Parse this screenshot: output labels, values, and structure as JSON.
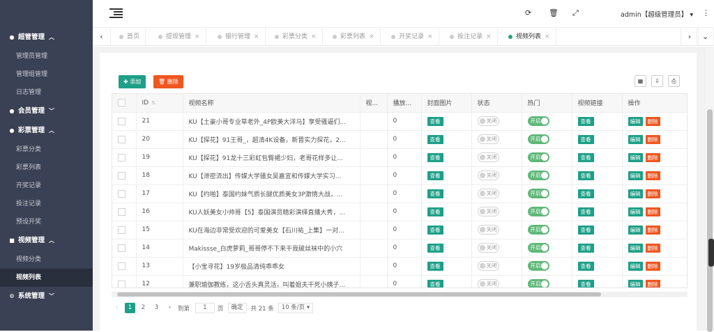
{
  "sidebar": {
    "groups": [
      {
        "label": "超管管理",
        "items": [
          "管理员管理",
          "管理组管理",
          "日志管理"
        ]
      },
      {
        "label": "会员管理",
        "items": []
      },
      {
        "label": "彩票管理",
        "items": [
          "彩票分类",
          "彩票列表",
          "开奖记录",
          "投注记录",
          "预设开奖"
        ]
      },
      {
        "label": "视频管理",
        "items": [
          "视频分类",
          "视频列表"
        ]
      },
      {
        "label": "系统管理",
        "items": []
      }
    ],
    "active_item": "视频列表"
  },
  "header": {
    "user": "admin【超级管理员】"
  },
  "tabs": [
    "首页",
    "提现管理",
    "银行管理",
    "彩票分类",
    "彩票列表",
    "开奖记录",
    "投注记录",
    "视频列表"
  ],
  "active_tab": "视频列表",
  "toolbar": {
    "add_label": "添加",
    "delete_label": "删除"
  },
  "table": {
    "columns": [
      "",
      "ID",
      "视频名称",
      "视...",
      "播放...",
      "封面图片",
      "状态",
      "热门",
      "视频链接",
      "操作"
    ],
    "cell_labels": {
      "view": "查看",
      "switch_off": "关闭",
      "switch_on": "开启",
      "edit": "编辑",
      "delete": "删除"
    },
    "rows": [
      {
        "id": "21",
        "name": "KU【土豪小哥专业草老外_4P欧美大洋马】享受骚逼们...",
        "plays": "0"
      },
      {
        "id": "20",
        "name": "KU【探花】91王哥_，超清4K设备，新晋实力探花，2...",
        "plays": "0"
      },
      {
        "id": "19",
        "name": "KU【探花】91龙十三彩虹包臀裙少妇，老哥花样多让...",
        "plays": "0"
      },
      {
        "id": "18",
        "name": "KU【泄密流出】传媒大学骚女吴嘉宜和传媒大学实习...",
        "plays": "0"
      },
      {
        "id": "17",
        "name": "KU【约啪】泰国约妹气质长腿优质美女3P激情大战，...",
        "plays": "0"
      },
      {
        "id": "16",
        "name": "KU人妖美女小帅哥【5】泰国演员精彩演绎直播大秀，...",
        "plays": "0"
      },
      {
        "id": "15",
        "name": "KU在海边非常受欢迎的可爱美女【石川祐_上集】一对...",
        "plays": "0"
      },
      {
        "id": "14",
        "name": "Makissse_白虎萝莉_哥哥停不下来干我破丝袜中的小穴",
        "plays": "0"
      },
      {
        "id": "13",
        "name": "【小宝寻花】19岁极品清纯乖乖女",
        "plays": "0"
      },
      {
        "id": "12",
        "name": "兼职瑜伽教练，这小舌头真灵活，叫着姐夫干死小姨子...",
        "plays": "0"
      }
    ]
  },
  "pager": {
    "pages": [
      "1",
      "2",
      "3"
    ],
    "current": "1",
    "goto_label": "到第",
    "goto_value": "1",
    "page_suffix": "页",
    "confirm": "确定",
    "total": "共 21 条",
    "per_page": "10 条/页"
  }
}
